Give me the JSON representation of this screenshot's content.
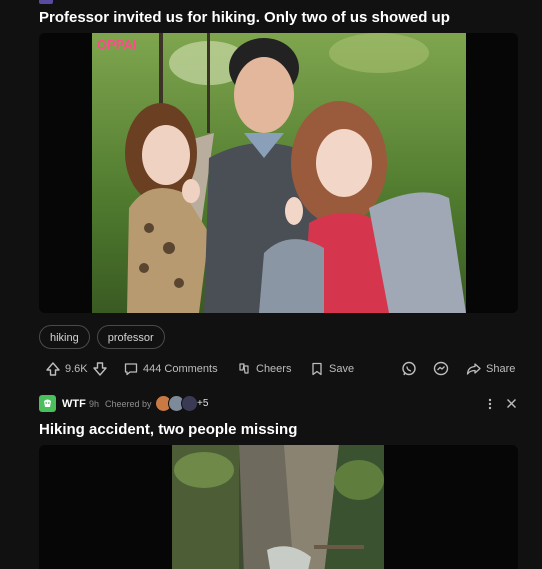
{
  "post1": {
    "title": "Professor invited us for hiking. Only two of us showed up",
    "image_watermark": "OPPAI",
    "tags": [
      "hiking",
      "professor"
    ],
    "votes": "9.6K",
    "comments": "444 Comments",
    "cheers": "Cheers",
    "save": "Save",
    "share": "Share"
  },
  "post2": {
    "community": "WTF",
    "age": "9h",
    "cheered_by": "Cheered by",
    "cheer_more": "+5",
    "title": "Hiking accident, two people missing"
  },
  "colors": {
    "background": "#111112",
    "community_icon": "#4bbf5c",
    "tag_border": "#4a4a4a"
  }
}
